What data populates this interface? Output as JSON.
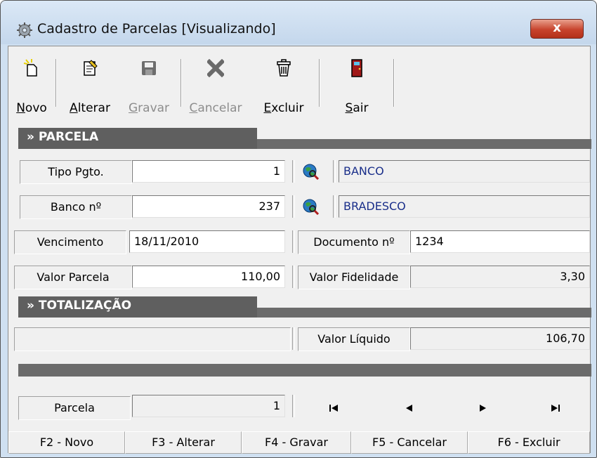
{
  "window": {
    "title": "Cadastro de Parcelas [Visualizando]",
    "close_label": "x"
  },
  "toolbar": {
    "novo": {
      "mnemonic": "N",
      "rest": "ovo"
    },
    "alterar": {
      "mnemonic": "A",
      "rest": "lterar"
    },
    "gravar": {
      "mnemonic": "G",
      "rest": "ravar"
    },
    "cancelar": {
      "mnemonic": "C",
      "rest": "ancelar"
    },
    "excluir": {
      "mnemonic": "E",
      "rest": "xcluir"
    },
    "sair": {
      "mnemonic": "S",
      "rest": "air"
    }
  },
  "sections": {
    "parcela": "» PARCELA",
    "totalizacao": "» TOTALIZAÇÃO"
  },
  "form": {
    "tipo_pgto": {
      "label": "Tipo Pgto.",
      "value": "1",
      "description": "BANCO"
    },
    "banco": {
      "label": "Banco nº",
      "value": "237",
      "description": "BRADESCO"
    },
    "vencimento": {
      "label": "Vencimento",
      "value": "18/11/2010"
    },
    "documento": {
      "label": "Documento nº",
      "value": "1234"
    },
    "valor_parcela": {
      "label": "Valor Parcela",
      "value": "110,00"
    },
    "valor_fidelidade": {
      "label": "Valor Fidelidade",
      "value": "3,30"
    }
  },
  "totals": {
    "valor_liquido": {
      "label": "Valor Líquido",
      "value": "106,70"
    }
  },
  "navigator": {
    "label": "Parcela",
    "value": "1"
  },
  "shortcuts": [
    "F2 - Novo",
    "F3 - Alterar",
    "F4 - Gravar",
    "F5 - Cancelar",
    "F6 - Excluir"
  ],
  "colors": {
    "section_bar": "#5f5f5f",
    "description_text": "#1a2f8a",
    "close_button": "#c7432c"
  }
}
